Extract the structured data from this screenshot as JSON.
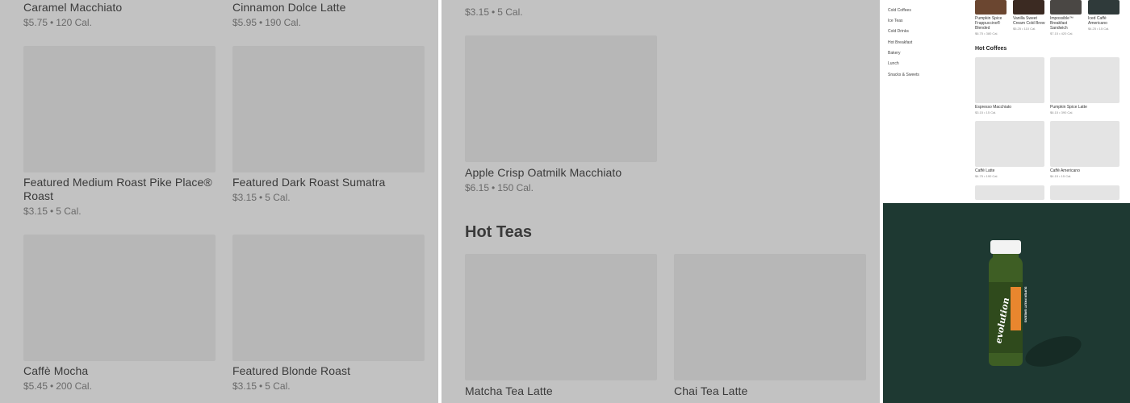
{
  "left_panel": {
    "items": [
      {
        "name": "Caramel Macchiato",
        "price": "$5.75",
        "cal": "120 Cal."
      },
      {
        "name": "Cinnamon Dolce Latte",
        "price": "$5.95",
        "cal": "190 Cal."
      },
      {
        "name": "Featured Medium Roast Pike Place® Roast",
        "price": "$3.15",
        "cal": "5 Cal."
      },
      {
        "name": "Featured Dark Roast Sumatra",
        "price": "$3.15",
        "cal": "5 Cal."
      },
      {
        "name": "Caffè Mocha",
        "price": "$5.45",
        "cal": "200 Cal."
      },
      {
        "name": "Featured Blonde Roast",
        "price": "$3.15",
        "cal": "5 Cal."
      }
    ]
  },
  "mid_panel": {
    "top_meta": {
      "price": "$3.15",
      "cal": "5 Cal."
    },
    "items": [
      {
        "name": "Apple Crisp Oatmilk Macchiato",
        "price": "$6.15",
        "cal": "150 Cal."
      },
      {
        "name": "Matcha Tea Latte"
      },
      {
        "name": "Chai Tea Latte"
      }
    ],
    "section_title": "Hot Teas"
  },
  "right_top_panel": {
    "nav": [
      "Cold Coffees",
      "Ice Teas",
      "Cold Drinks",
      "Hot Breakfast",
      "Bakery",
      "Lunch",
      "Snacks & Sweets"
    ],
    "top_items": [
      {
        "name": "Pumpkin Spice Frappuccino® Blended",
        "meta": "$6.75 • 380 Cal."
      },
      {
        "name": "Vanilla Sweet Cream Cold Brew",
        "meta": "$5.25 • 110 Cal."
      },
      {
        "name": "Impossible™ Breakfast Sandwich",
        "meta": "$7.15 • 420 Cal."
      },
      {
        "name": "Iced Caffè Americano",
        "meta": "$4.25 • 15 Cal."
      }
    ],
    "section_title": "Hot Coffees",
    "items": [
      {
        "name": "Espresso Macchiato",
        "meta": "$3.15 • 15 Cal."
      },
      {
        "name": "Pumpkin Spice Latte",
        "meta": "$6.15 • 390 Cal."
      },
      {
        "name": "Caffè Latte",
        "meta": "$4.75 • 190 Cal."
      },
      {
        "name": "Caffè Americano",
        "meta": "$4.15 • 15 Cal."
      }
    ]
  },
  "right_bottom_panel": {
    "brand": "evolution",
    "band": "SUPER FRUIT GREENS"
  }
}
